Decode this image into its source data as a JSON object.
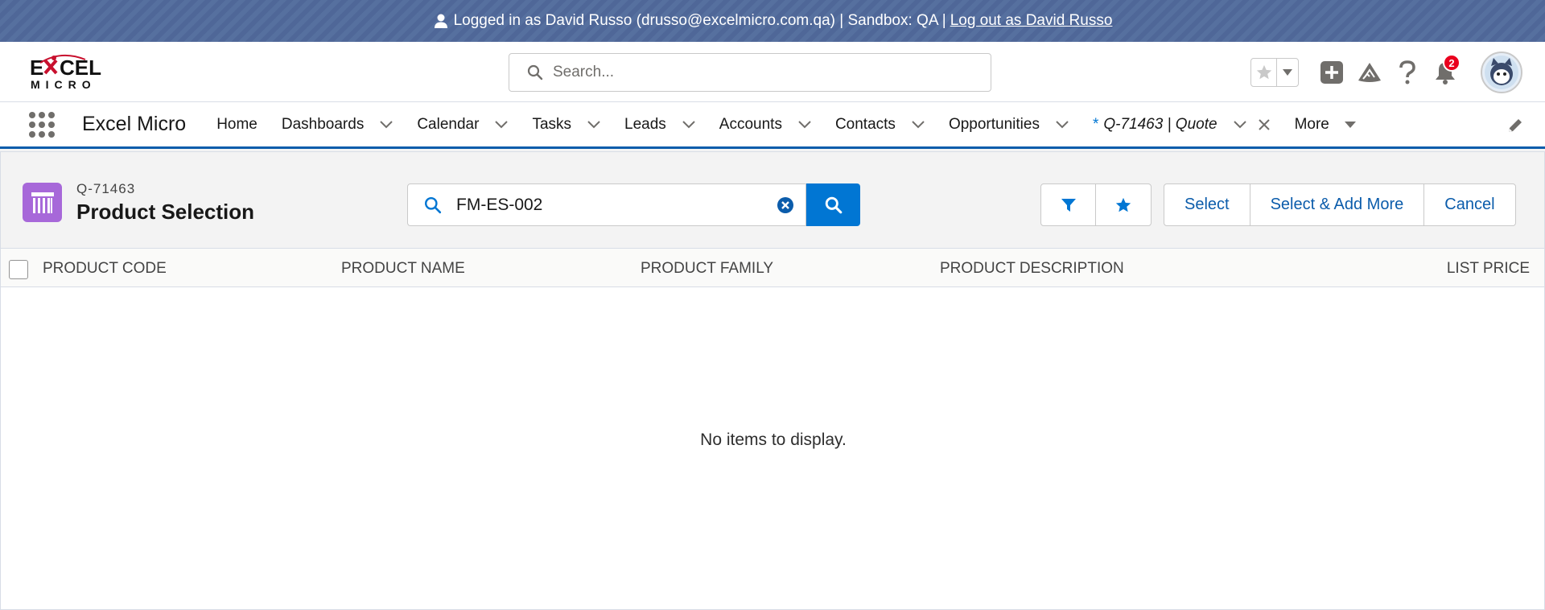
{
  "banner": {
    "text": "Logged in as David Russo (drusso@excelmicro.com.qa) | Sandbox: QA |",
    "logout_link": "Log out as David Russo"
  },
  "header": {
    "search_placeholder": "Search...",
    "notification_count": "2",
    "icons": [
      "favorites-star-icon",
      "favorites-dropdown-icon",
      "global-actions-plus-icon",
      "trailhead-icon",
      "help-icon",
      "notifications-bell-icon",
      "avatar"
    ]
  },
  "logo": {
    "line1": "EXCEL",
    "line2": "MICRO"
  },
  "nav": {
    "app_name": "Excel Micro",
    "items": [
      {
        "label": "Home",
        "has_dropdown": false
      },
      {
        "label": "Dashboards",
        "has_dropdown": true
      },
      {
        "label": "Calendar",
        "has_dropdown": true
      },
      {
        "label": "Tasks",
        "has_dropdown": true
      },
      {
        "label": "Leads",
        "has_dropdown": true
      },
      {
        "label": "Accounts",
        "has_dropdown": true
      },
      {
        "label": "Contacts",
        "has_dropdown": true
      },
      {
        "label": "Opportunities",
        "has_dropdown": true
      }
    ],
    "active_tab": {
      "marker": "*",
      "label": "Q-71463 | Quote"
    },
    "more_label": "More"
  },
  "panel": {
    "record_id": "Q-71463",
    "title": "Product Selection",
    "search_value": "FM-ES-002",
    "actions": {
      "select": "Select",
      "select_add_more": "Select & Add More",
      "cancel": "Cancel"
    },
    "columns": [
      "PRODUCT CODE",
      "PRODUCT NAME",
      "PRODUCT FAMILY",
      "PRODUCT DESCRIPTION",
      "LIST PRICE"
    ],
    "empty_message": "No items to display."
  },
  "colors": {
    "brand_blue": "#0176d3",
    "banner": "#4f6798",
    "object_icon": "#a768d9",
    "badge_red": "#ea001e"
  }
}
